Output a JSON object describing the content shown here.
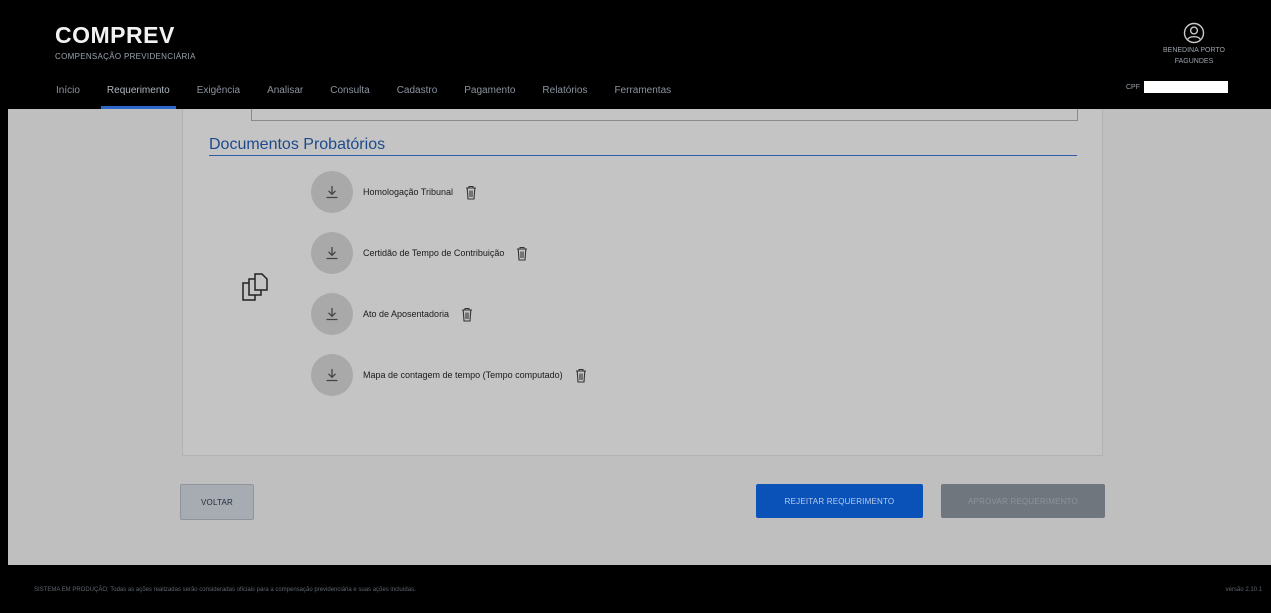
{
  "header": {
    "title": "COMPREV",
    "subtitle": "COMPENSAÇÃO PREVIDENCIÁRIA",
    "nav": [
      {
        "label": "Início",
        "active": false
      },
      {
        "label": "Requerimento",
        "active": true
      },
      {
        "label": "Exigência",
        "active": false
      },
      {
        "label": "Analisar",
        "active": false
      },
      {
        "label": "Consulta",
        "active": false
      },
      {
        "label": "Cadastro",
        "active": false
      },
      {
        "label": "Pagamento",
        "active": false
      },
      {
        "label": "Relatórios",
        "active": false
      },
      {
        "label": "Ferramentas",
        "active": false
      }
    ],
    "user": {
      "name_line1": "BENEDINA PORTO",
      "name_line2": "FAGUNDES",
      "cpf_label": "CPF",
      "cpf_value": ""
    }
  },
  "section": {
    "title": "Documentos Probatórios"
  },
  "documents": [
    {
      "label": "Homologação Tribunal"
    },
    {
      "label": "Certidão de Tempo de Contribuição"
    },
    {
      "label": "Ato de Aposentadoria"
    },
    {
      "label": "Mapa de contagem de tempo (Tempo computado)"
    }
  ],
  "buttons": {
    "back": "VOLTAR",
    "reject": "REJEITAR REQUERIMENTO",
    "approve": "APROVAR REQUERIMENTO"
  },
  "footer": {
    "text": "SISTEMA EM PRODUÇÃO: Todas as ações realizadas serão consideradas oficiais para a compensação previdenciária e suas ações incluídas.",
    "version": "versão 2.10.1"
  },
  "colors": {
    "accent": "#2a67c9",
    "reject_button": "#0a52b8",
    "section_title": "#1e4a8c",
    "overlay_background": "#bfbfbf"
  }
}
